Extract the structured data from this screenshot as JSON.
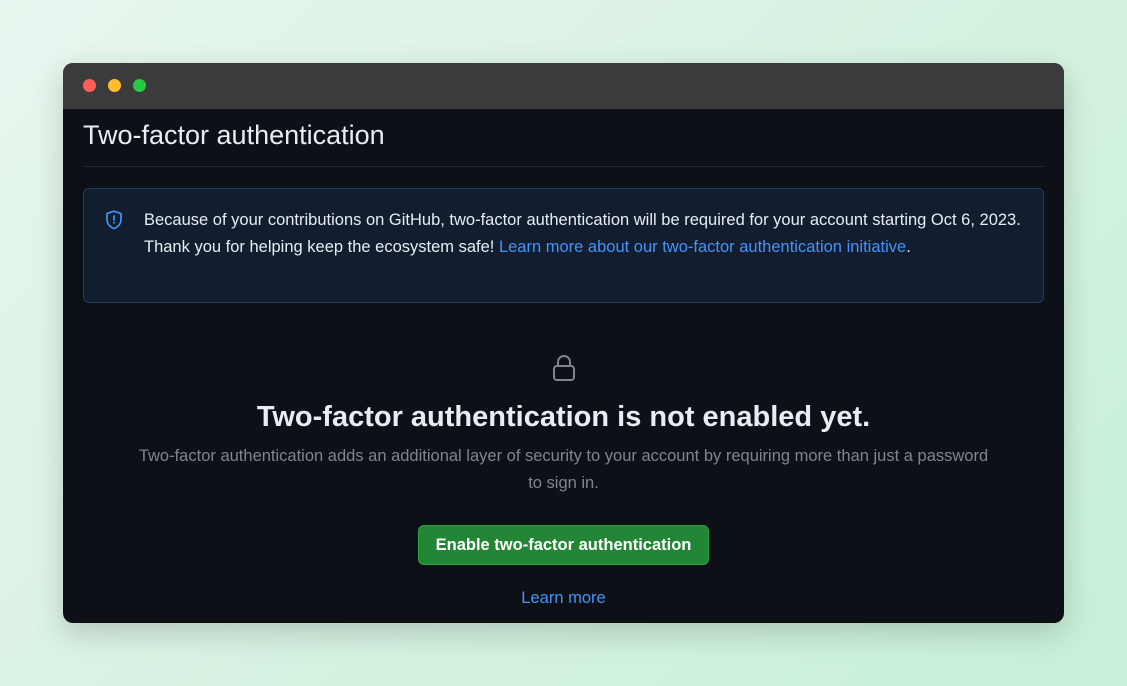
{
  "window": {
    "controls": [
      "close",
      "minimize",
      "maximize"
    ]
  },
  "page": {
    "title": "Two-factor authentication"
  },
  "notice": {
    "icon": "shield-icon",
    "text": "Because of your contributions on GitHub, two-factor authentication will be required for your account starting Oct 6, 2023. Thank you for helping keep the ecosystem safe! ",
    "link_text": "Learn more about our two-factor authentication initiative",
    "trailing": "."
  },
  "empty_state": {
    "icon": "lock-icon",
    "title": "Two-factor authentication is not enabled yet.",
    "description": "Two-factor authentication adds an additional layer of security to your account by requiring more than just a password to sign in.",
    "button_label": "Enable two-factor authentication",
    "learn_more": "Learn more"
  },
  "colors": {
    "background": "#0d1117",
    "accent_green": "#238636",
    "link_blue": "#4493f8",
    "notice_bg": "#121d2f",
    "notice_border": "#1f3a5f"
  }
}
